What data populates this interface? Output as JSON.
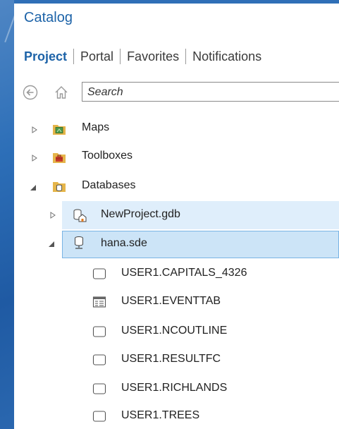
{
  "panel": {
    "title": "Catalog"
  },
  "tabs": [
    {
      "label": "Project",
      "active": true
    },
    {
      "label": "Portal",
      "active": false
    },
    {
      "label": "Favorites",
      "active": false
    },
    {
      "label": "Notifications",
      "active": false
    }
  ],
  "search": {
    "placeholder": "Search"
  },
  "tree": {
    "maps": "Maps",
    "toolboxes": "Toolboxes",
    "databases": "Databases",
    "newproject": "NewProject.gdb",
    "hana": "hana.sde",
    "children": [
      {
        "label": "USER1.CAPITALS_4326",
        "icon": "feature-class-icon"
      },
      {
        "label": "USER1.EVENTTAB",
        "icon": "table-icon"
      },
      {
        "label": "USER1.NCOUTLINE",
        "icon": "feature-class-icon"
      },
      {
        "label": "USER1.RESULTFC",
        "icon": "feature-class-icon"
      },
      {
        "label": "USER1.RICHLANDS",
        "icon": "feature-class-icon"
      },
      {
        "label": "USER1.TREES",
        "icon": "feature-class-icon"
      }
    ]
  },
  "colors": {
    "accent": "#1d63a8",
    "selection": "#cce4f7",
    "hover": "#dfeefb"
  }
}
